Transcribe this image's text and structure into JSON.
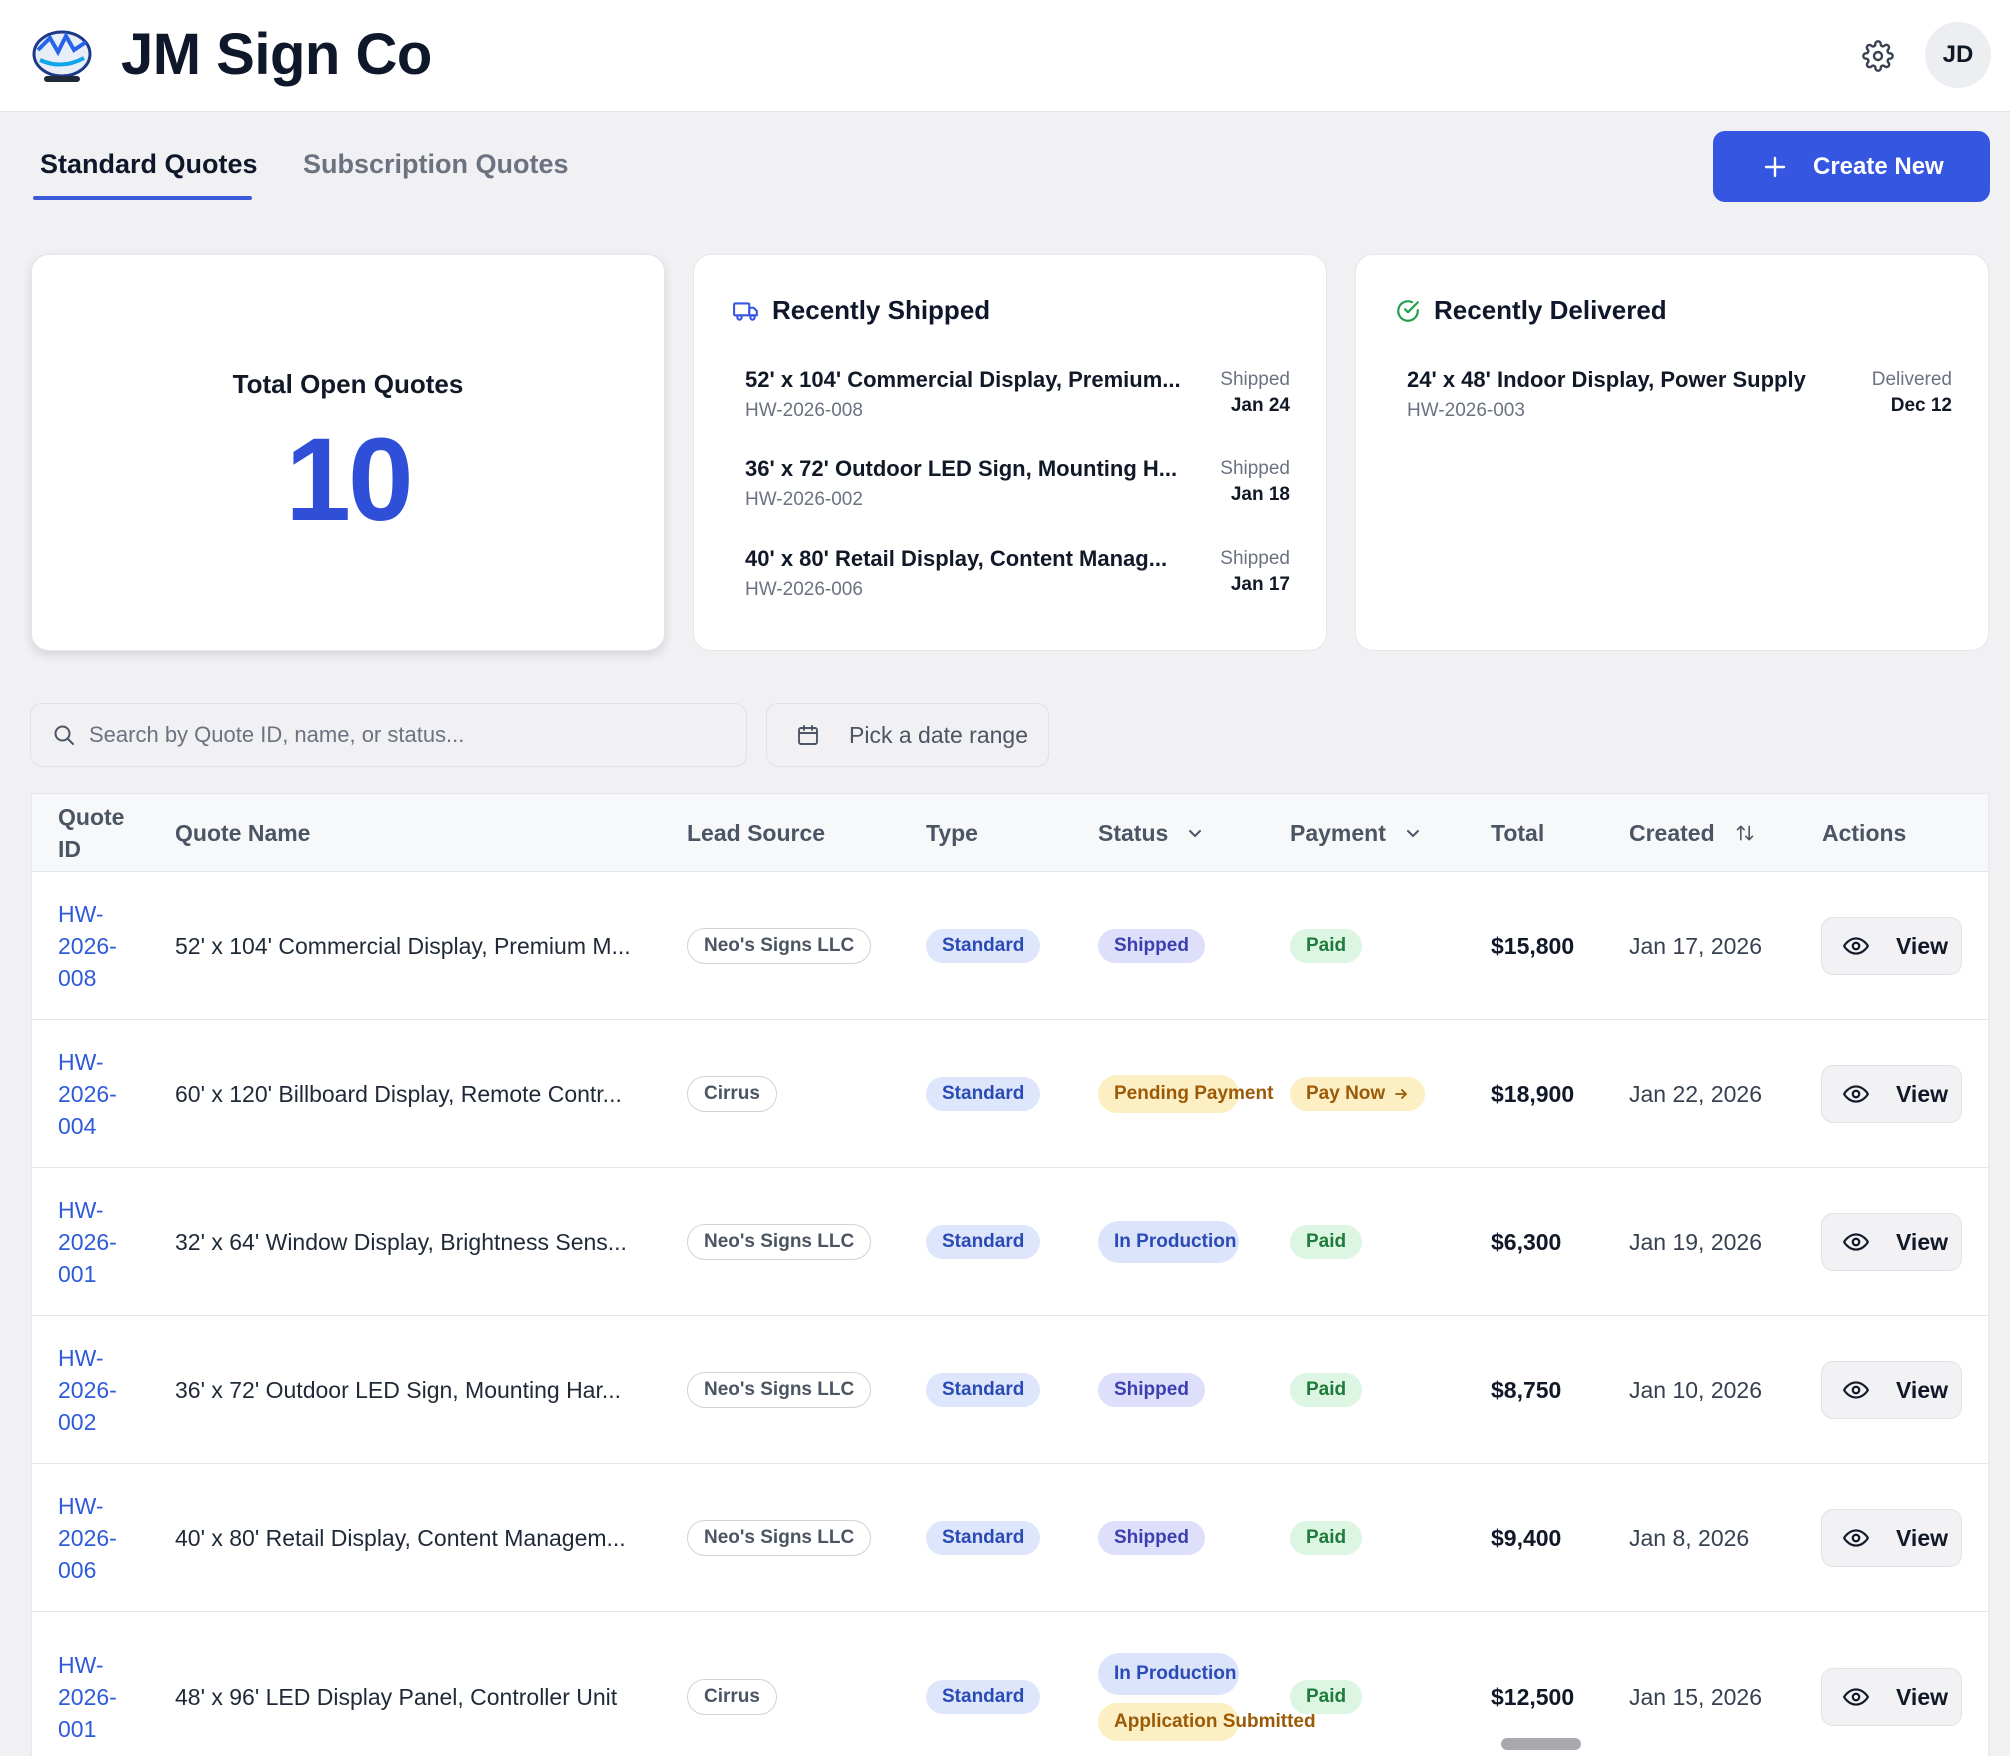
{
  "header": {
    "brand": "JM Sign Co",
    "avatar_initials": "JD",
    "icons": {
      "settings": "gear-icon",
      "logo": "logo-emblem"
    }
  },
  "tabs": [
    {
      "label": "Standard Quotes",
      "active": true
    },
    {
      "label": "Subscription Quotes",
      "active": false
    }
  ],
  "create_button": {
    "label": "Create New"
  },
  "summary": {
    "total_open": {
      "label": "Total Open Quotes",
      "value": "10"
    },
    "recently_shipped": {
      "title": "Recently Shipped",
      "items": [
        {
          "name": "52' x 104' Commercial Display, Premium...",
          "id": "HW-2026-008",
          "status": "Shipped",
          "date": "Jan 24"
        },
        {
          "name": "36' x 72' Outdoor LED Sign, Mounting H...",
          "id": "HW-2026-002",
          "status": "Shipped",
          "date": "Jan 18"
        },
        {
          "name": "40' x 80' Retail Display, Content Manag...",
          "id": "HW-2026-006",
          "status": "Shipped",
          "date": "Jan 17"
        }
      ]
    },
    "recently_delivered": {
      "title": "Recently Delivered",
      "items": [
        {
          "name": "24' x 48' Indoor Display, Power Supply",
          "id": "HW-2026-003",
          "status": "Delivered",
          "date": "Dec 12"
        }
      ]
    }
  },
  "filters": {
    "search_placeholder": "Search by Quote ID, name, or status...",
    "date_range_label": "Pick a date range"
  },
  "table": {
    "headers": {
      "quote_id": "Quote ID",
      "quote_name": "Quote Name",
      "lead_source": "Lead Source",
      "type": "Type",
      "status": "Status",
      "payment": "Payment",
      "total": "Total",
      "created": "Created",
      "actions": "Actions"
    },
    "view_label": "View",
    "rows": [
      {
        "id": "HW-2026-008",
        "id_lines": [
          "HW-",
          "2026-",
          "008"
        ],
        "name": "52' x 104' Commercial Display, Premium M...",
        "source": "Neo's Signs LLC",
        "type": "Standard",
        "status": [
          "Shipped"
        ],
        "payment": "Paid",
        "total": "$15,800",
        "created": "Jan 17, 2026"
      },
      {
        "id": "HW-2026-004",
        "id_lines": [
          "HW-",
          "2026-",
          "004"
        ],
        "name": "60' x 120' Billboard Display, Remote Contr...",
        "source": "Cirrus",
        "type": "Standard",
        "status": [
          "Pending Payment"
        ],
        "payment": "Pay Now",
        "total": "$18,900",
        "created": "Jan 22, 2026"
      },
      {
        "id": "HW-2026-001",
        "id_lines": [
          "HW-",
          "2026-",
          "001"
        ],
        "name": "32' x 64' Window Display, Brightness Sens...",
        "source": "Neo's Signs LLC",
        "type": "Standard",
        "status": [
          "In Production"
        ],
        "payment": "Paid",
        "total": "$6,300",
        "created": "Jan 19, 2026"
      },
      {
        "id": "HW-2026-002",
        "id_lines": [
          "HW-",
          "2026-",
          "002"
        ],
        "name": "36' x 72' Outdoor LED Sign, Mounting Har...",
        "source": "Neo's Signs LLC",
        "type": "Standard",
        "status": [
          "Shipped"
        ],
        "payment": "Paid",
        "total": "$8,750",
        "created": "Jan 10, 2026"
      },
      {
        "id": "HW-2026-006",
        "id_lines": [
          "HW-",
          "2026-",
          "006"
        ],
        "name": "40' x 80' Retail Display, Content Managem...",
        "source": "Neo's Signs LLC",
        "type": "Standard",
        "status": [
          "Shipped"
        ],
        "payment": "Paid",
        "total": "$9,400",
        "created": "Jan 8, 2026"
      },
      {
        "id": "HW-2026-001",
        "id_lines": [
          "HW-",
          "2026-",
          "001"
        ],
        "name": "48' x 96' LED Display Panel, Controller Unit",
        "source": "Cirrus",
        "type": "Standard",
        "status": [
          "In Production",
          "Application Submitted"
        ],
        "payment": "Paid",
        "total": "$12,500",
        "created": "Jan 15, 2026"
      }
    ]
  },
  "colors": {
    "accent": "#3556e0",
    "link": "#2f5ad8",
    "total_value": "#2f4fd8"
  }
}
